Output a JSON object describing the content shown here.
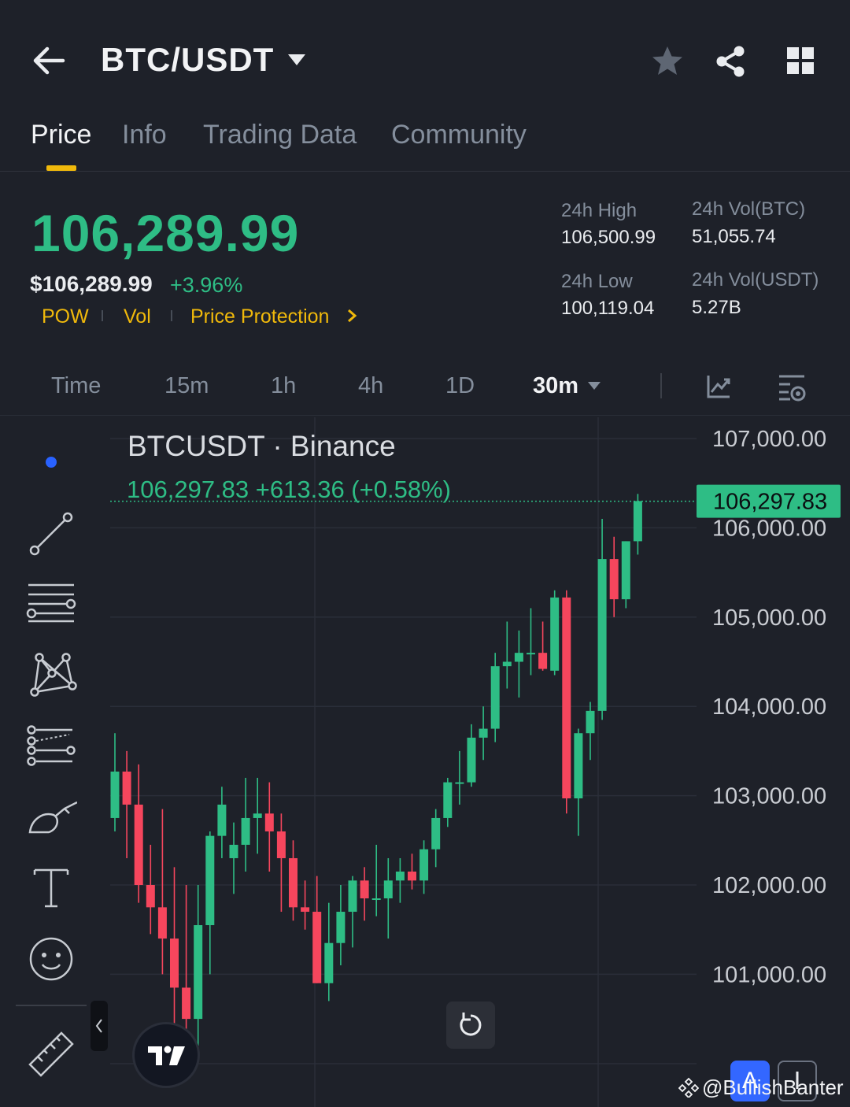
{
  "header": {
    "pair": "BTC/USDT",
    "tabs": [
      {
        "label": "Price"
      },
      {
        "label": "Info"
      },
      {
        "label": "Trading Data"
      },
      {
        "label": "Community"
      }
    ]
  },
  "summary": {
    "last_price": "106,289.99",
    "usd_price": "$106,289.99",
    "change_pct": "+3.96%",
    "tags": [
      "POW",
      "Vol",
      "Price Protection"
    ],
    "high_label": "24h High",
    "high_value": "106,500.99",
    "low_label": "24h Low",
    "low_value": "100,119.04",
    "vol_btc_label": "24h Vol(BTC)",
    "vol_btc_value": "51,055.74",
    "vol_usdt_label": "24h Vol(USDT)",
    "vol_usdt_value": "5.27B"
  },
  "intervals": {
    "items": [
      "Time",
      "15m",
      "1h",
      "4h",
      "1D"
    ],
    "active": "30m"
  },
  "colors": {
    "up": "#2ebd85",
    "down": "#f6465d",
    "accent": "#f0b90b",
    "background": "#1e2129"
  },
  "chart_header": {
    "title": "BTCUSDT · Binance",
    "quote": "106,297.83  +613.36 (+0.58%)",
    "price_tag": "106,297.83"
  },
  "watermark": "@BullishBanter",
  "a_button": "A",
  "chart_data": {
    "type": "candlestick",
    "ylim": [
      100300,
      107200
    ],
    "y_ticks": [
      "107,000.00",
      "106,000.00",
      "105,000.00",
      "104,000.00",
      "103,000.00",
      "102,000.00",
      "101,000.00"
    ],
    "y_tick_values": [
      107000,
      106000,
      105000,
      104000,
      103000,
      102000,
      101000
    ],
    "last_price": 106297.83,
    "candles": [
      {
        "o": 102750,
        "h": 103700,
        "l": 102600,
        "c": 103270
      },
      {
        "o": 103270,
        "h": 103500,
        "l": 102300,
        "c": 102900
      },
      {
        "o": 102900,
        "h": 103350,
        "l": 101800,
        "c": 102000
      },
      {
        "o": 102000,
        "h": 102450,
        "l": 101450,
        "c": 101750
      },
      {
        "o": 101750,
        "h": 102850,
        "l": 101000,
        "c": 101400
      },
      {
        "o": 101400,
        "h": 102200,
        "l": 100300,
        "c": 100850
      },
      {
        "o": 100850,
        "h": 102000,
        "l": 100300,
        "c": 100500
      },
      {
        "o": 100500,
        "h": 102000,
        "l": 100200,
        "c": 101550
      },
      {
        "o": 101550,
        "h": 102600,
        "l": 101000,
        "c": 102550
      },
      {
        "o": 102550,
        "h": 103100,
        "l": 102300,
        "c": 102900
      },
      {
        "o": 102300,
        "h": 102700,
        "l": 101900,
        "c": 102450
      },
      {
        "o": 102450,
        "h": 103200,
        "l": 102150,
        "c": 102750
      },
      {
        "o": 102750,
        "h": 103200,
        "l": 102350,
        "c": 102800
      },
      {
        "o": 102800,
        "h": 103150,
        "l": 102150,
        "c": 102600
      },
      {
        "o": 102600,
        "h": 102800,
        "l": 101700,
        "c": 102300
      },
      {
        "o": 102300,
        "h": 102500,
        "l": 101600,
        "c": 101750
      },
      {
        "o": 101750,
        "h": 102050,
        "l": 101500,
        "c": 101700
      },
      {
        "o": 101700,
        "h": 102100,
        "l": 100900,
        "c": 100900
      },
      {
        "o": 100900,
        "h": 101800,
        "l": 100700,
        "c": 101350
      },
      {
        "o": 101350,
        "h": 102000,
        "l": 101100,
        "c": 101700
      },
      {
        "o": 101700,
        "h": 102100,
        "l": 101300,
        "c": 102050
      },
      {
        "o": 102050,
        "h": 102200,
        "l": 101600,
        "c": 101850
      },
      {
        "o": 101850,
        "h": 102450,
        "l": 101650,
        "c": 101850
      },
      {
        "o": 101850,
        "h": 102300,
        "l": 101400,
        "c": 102050
      },
      {
        "o": 102050,
        "h": 102300,
        "l": 101800,
        "c": 102150
      },
      {
        "o": 102150,
        "h": 102350,
        "l": 101950,
        "c": 102050
      },
      {
        "o": 102050,
        "h": 102500,
        "l": 101900,
        "c": 102400
      },
      {
        "o": 102400,
        "h": 102850,
        "l": 102200,
        "c": 102750
      },
      {
        "o": 102750,
        "h": 103200,
        "l": 102650,
        "c": 103150
      },
      {
        "o": 103150,
        "h": 103500,
        "l": 102900,
        "c": 103150
      },
      {
        "o": 103150,
        "h": 103800,
        "l": 103100,
        "c": 103650
      },
      {
        "o": 103650,
        "h": 104000,
        "l": 103400,
        "c": 103750
      },
      {
        "o": 103750,
        "h": 104600,
        "l": 103600,
        "c": 104450
      },
      {
        "o": 104450,
        "h": 104950,
        "l": 104200,
        "c": 104500
      },
      {
        "o": 104500,
        "h": 104850,
        "l": 104100,
        "c": 104600
      },
      {
        "o": 104600,
        "h": 105100,
        "l": 104350,
        "c": 104600
      },
      {
        "o": 104600,
        "h": 104950,
        "l": 104400,
        "c": 104420
      },
      {
        "o": 104400,
        "h": 105300,
        "l": 104350,
        "c": 105220
      },
      {
        "o": 105220,
        "h": 105300,
        "l": 102800,
        "c": 102970
      },
      {
        "o": 102970,
        "h": 103750,
        "l": 102550,
        "c": 103700
      },
      {
        "o": 103700,
        "h": 104050,
        "l": 103400,
        "c": 103950
      },
      {
        "o": 103950,
        "h": 106100,
        "l": 103850,
        "c": 105650
      },
      {
        "o": 105650,
        "h": 105900,
        "l": 105000,
        "c": 105200
      },
      {
        "o": 105200,
        "h": 105850,
        "l": 105100,
        "c": 105850
      },
      {
        "o": 105850,
        "h": 106380,
        "l": 105700,
        "c": 106300
      }
    ]
  }
}
